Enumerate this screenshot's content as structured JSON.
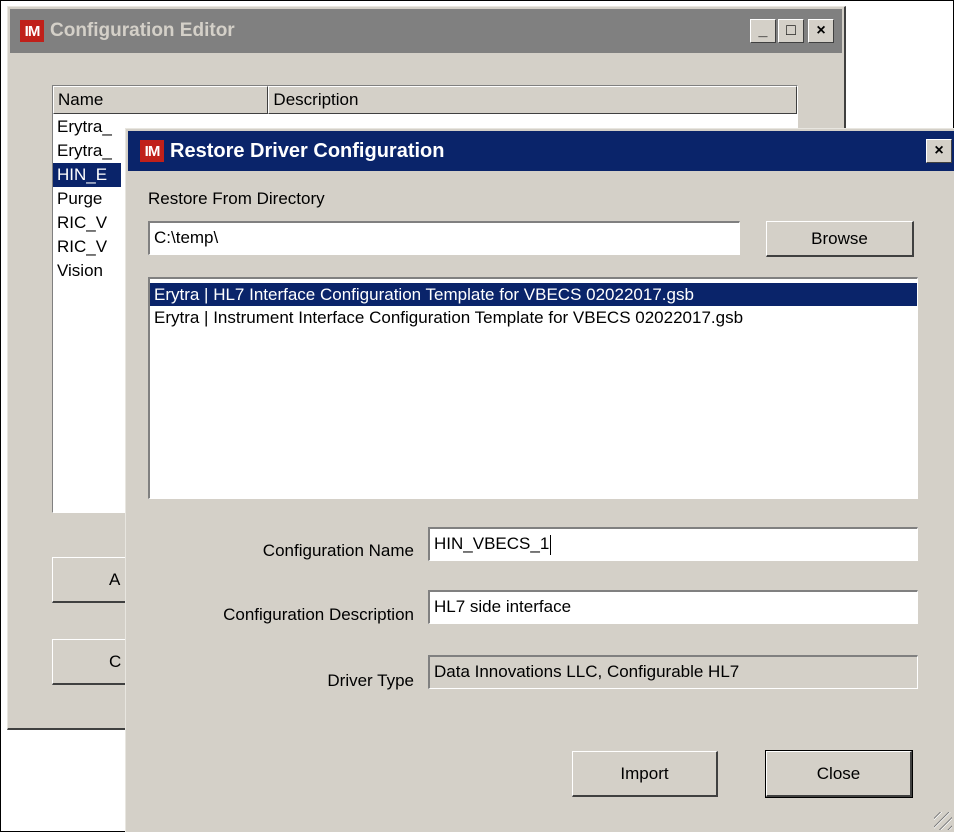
{
  "back_window": {
    "app_icon": "IM",
    "title": "Configuration Editor",
    "minimize_glyph": "_",
    "maximize_glyph": "□",
    "close_glyph": "×",
    "columns": [
      "Name",
      "Description"
    ],
    "rows": [
      "Erytra_",
      "Erytra_",
      "HIN_E",
      "Purge",
      "RIC_V",
      "RIC_V",
      "Vision"
    ],
    "selected_row_index": 2,
    "buttons": [
      "A",
      "C"
    ]
  },
  "dialog": {
    "app_icon": "IM",
    "title": "Restore Driver Configuration",
    "close_glyph": "×",
    "restore_from_label": "Restore From Directory",
    "directory_value": "C:\\temp\\",
    "browse_label": "Browse",
    "files": [
      "Erytra | HL7 Interface Configuration Template for VBECS 02022017.gsb",
      "Erytra | Instrument Interface Configuration Template for VBECS 02022017.gsb"
    ],
    "selected_file_index": 0,
    "config_name_label": "Configuration Name",
    "config_name_value": "HIN_VBECS_1",
    "config_desc_label": "Configuration Description",
    "config_desc_value": "HL7 side interface",
    "driver_type_label": "Driver Type",
    "driver_type_value": "Data Innovations LLC, Configurable HL7",
    "import_label": "Import",
    "close_label": "Close"
  },
  "colors": {
    "dialog_face": "#d4d0c8",
    "active_title": "#0a246a",
    "inactive_title": "#808080",
    "selection": "#0a246a",
    "icon_red": "#c0201a"
  }
}
